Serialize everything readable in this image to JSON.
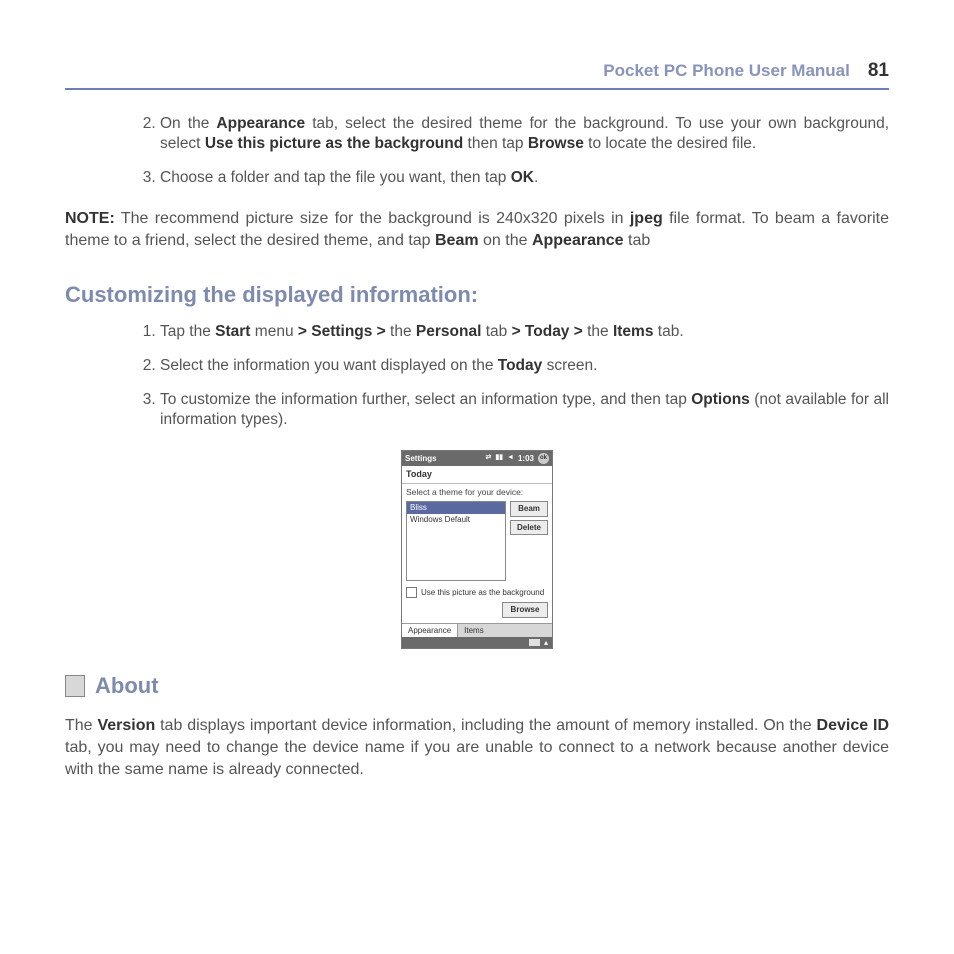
{
  "header": {
    "title": "Pocket PC Phone User Manual",
    "page": "81"
  },
  "steps_top": {
    "s2_a": "On the ",
    "s2_b": "Appearance",
    "s2_c": " tab, select the desired theme for the background. To use your own background, select ",
    "s2_d": "Use this picture as the background",
    "s2_e": " then tap ",
    "s2_f": "Browse",
    "s2_g": " to locate the desired file.",
    "s3_a": "Choose a folder and tap the file you want, then tap ",
    "s3_b": "OK",
    "s3_c": "."
  },
  "note": {
    "label": "NOTE:",
    "a": " The recommend picture size for the background is 240x320 pixels in ",
    "b": "jpeg",
    "c": " file format. To beam a favorite theme to a friend, select the desired theme, and tap ",
    "d": "Beam",
    "e": " on the ",
    "f": "Appearance",
    "g": " tab"
  },
  "section1": "Customizing the displayed information:",
  "steps_custom": {
    "s1_a": "Tap the ",
    "s1_b": "Start",
    "s1_c": " menu ",
    "s1_d": "> Settings >",
    "s1_e": " the ",
    "s1_f": "Personal",
    "s1_g": " tab ",
    "s1_h": "> Today >",
    "s1_i": " the ",
    "s1_j": "Items",
    "s1_k": " tab.",
    "s2_a": "Select the information you want displayed on the ",
    "s2_b": "Today",
    "s2_c": " screen.",
    "s3_a": "To customize the information further, select an information type, and then tap ",
    "s3_b": "Options",
    "s3_c": " (not available for all information types)."
  },
  "device": {
    "title": "Settings",
    "time": "1:03",
    "subtitle": "Today",
    "prompt": "Select a theme for your device:",
    "items": [
      "Bliss",
      "Windows Default"
    ],
    "beam": "Beam",
    "delete": "Delete",
    "checkbox_label": "Use this picture as the background",
    "browse": "Browse",
    "tab_appearance": "Appearance",
    "tab_items": "Items",
    "ok": "ok"
  },
  "about": {
    "heading": "About",
    "a": "The ",
    "b": "Version",
    "c": " tab displays important device information, including the amount of memory installed. On the ",
    "d": "Device ID",
    "e": " tab, you may need to change the device name if you are unable to connect to a network because another device with the same name is already connected."
  }
}
